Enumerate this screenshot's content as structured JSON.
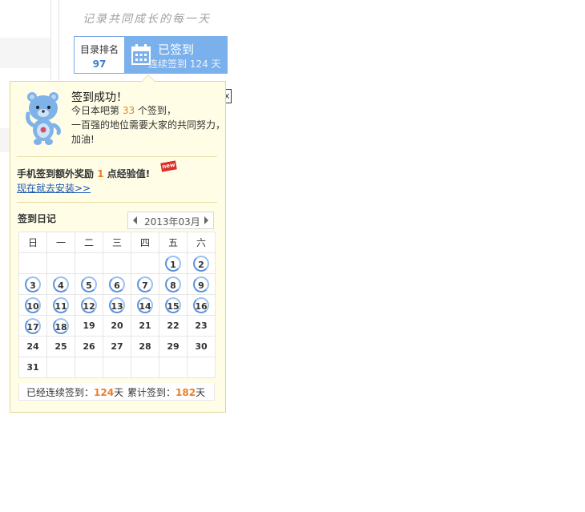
{
  "slogan": "记录共同成长的每一天",
  "rank": {
    "label": "目录排名",
    "value": "97"
  },
  "signed": {
    "title": "已签到",
    "subtitle": "连续签到 124 天"
  },
  "success": {
    "title": "签到成功！",
    "line1_prefix": "今日本吧第 ",
    "line1_rank": "33",
    "line1_suffix": " 个签到，",
    "line2": "一百强的地位需要大家的共同努力，",
    "line3": "加油!"
  },
  "mobile": {
    "prefix": "手机签到额外奖励 ",
    "points": "1",
    "suffix": " 点经验值!",
    "badge": "new",
    "install_link": "现在就去安装>>"
  },
  "diary": {
    "title": "签到日记",
    "month": "2013年03月",
    "weekdays": [
      "日",
      "一",
      "二",
      "三",
      "四",
      "五",
      "六"
    ],
    "weeks": [
      [
        null,
        null,
        null,
        null,
        null,
        {
          "d": "1",
          "s": true
        },
        {
          "d": "2",
          "s": true
        }
      ],
      [
        {
          "d": "3",
          "s": true
        },
        {
          "d": "4",
          "s": true
        },
        {
          "d": "5",
          "s": true
        },
        {
          "d": "6",
          "s": true
        },
        {
          "d": "7",
          "s": true
        },
        {
          "d": "8",
          "s": true
        },
        {
          "d": "9",
          "s": true
        }
      ],
      [
        {
          "d": "10",
          "s": true
        },
        {
          "d": "11",
          "s": true
        },
        {
          "d": "12",
          "s": true
        },
        {
          "d": "13",
          "s": true
        },
        {
          "d": "14",
          "s": true
        },
        {
          "d": "15",
          "s": true
        },
        {
          "d": "16",
          "s": true
        }
      ],
      [
        {
          "d": "17",
          "s": true
        },
        {
          "d": "18",
          "s": true
        },
        {
          "d": "19",
          "s": false
        },
        {
          "d": "20",
          "s": false
        },
        {
          "d": "21",
          "s": false
        },
        {
          "d": "22",
          "s": false
        },
        {
          "d": "23",
          "s": false
        }
      ],
      [
        {
          "d": "24",
          "s": false
        },
        {
          "d": "25",
          "s": false
        },
        {
          "d": "26",
          "s": false
        },
        {
          "d": "27",
          "s": false
        },
        {
          "d": "28",
          "s": false
        },
        {
          "d": "29",
          "s": false
        },
        {
          "d": "30",
          "s": false
        }
      ],
      [
        {
          "d": "31",
          "s": false
        },
        null,
        null,
        null,
        null,
        null,
        null
      ]
    ],
    "footer": {
      "consecutive_label": "已经连续签到：",
      "consecutive_value": "124",
      "total_label": "累计签到：",
      "total_value": "182",
      "unit": "天"
    }
  },
  "colors": {
    "accent_blue": "#7ab0ec",
    "highlight_orange": "#e87f2a",
    "popup_bg": "#fffde6",
    "link": "#1a56b4"
  },
  "icons": {
    "calendar": "calendar-icon",
    "mascot": "bear-mascot-icon",
    "prev": "triangle-left-icon",
    "next": "triangle-right-icon"
  }
}
